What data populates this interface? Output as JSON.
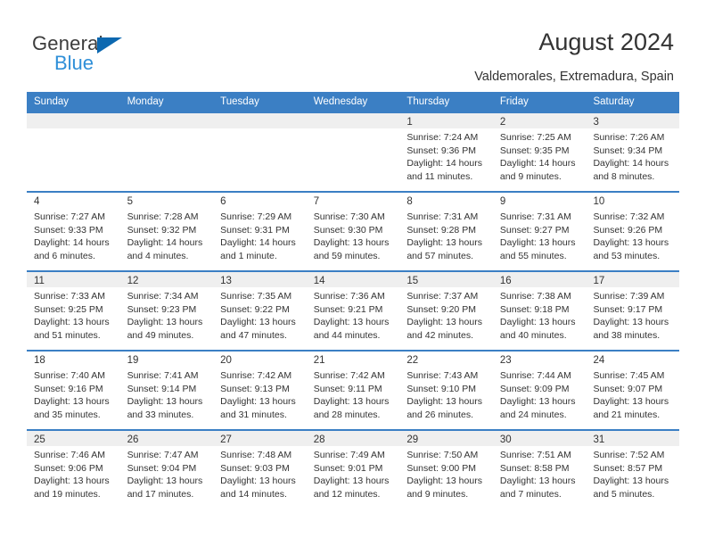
{
  "brand": {
    "name_top": "General",
    "name_bottom": "Blue",
    "triangle_icon": "triangle-icon",
    "accent_dark": "#0c68b0",
    "accent_light": "#2f8fd8"
  },
  "header": {
    "title": "August 2024",
    "subtitle": "Valdemorales, Extremadura, Spain"
  },
  "calendar": {
    "header_color": "#3b7fc4",
    "weekdays": [
      "Sunday",
      "Monday",
      "Tuesday",
      "Wednesday",
      "Thursday",
      "Friday",
      "Saturday"
    ],
    "weeks": [
      [
        {
          "day": "",
          "lines": []
        },
        {
          "day": "",
          "lines": []
        },
        {
          "day": "",
          "lines": []
        },
        {
          "day": "",
          "lines": []
        },
        {
          "day": "1",
          "lines": [
            "Sunrise: 7:24 AM",
            "Sunset: 9:36 PM",
            "Daylight: 14 hours",
            "and 11 minutes."
          ]
        },
        {
          "day": "2",
          "lines": [
            "Sunrise: 7:25 AM",
            "Sunset: 9:35 PM",
            "Daylight: 14 hours",
            "and 9 minutes."
          ]
        },
        {
          "day": "3",
          "lines": [
            "Sunrise: 7:26 AM",
            "Sunset: 9:34 PM",
            "Daylight: 14 hours",
            "and 8 minutes."
          ]
        }
      ],
      [
        {
          "day": "4",
          "lines": [
            "Sunrise: 7:27 AM",
            "Sunset: 9:33 PM",
            "Daylight: 14 hours",
            "and 6 minutes."
          ]
        },
        {
          "day": "5",
          "lines": [
            "Sunrise: 7:28 AM",
            "Sunset: 9:32 PM",
            "Daylight: 14 hours",
            "and 4 minutes."
          ]
        },
        {
          "day": "6",
          "lines": [
            "Sunrise: 7:29 AM",
            "Sunset: 9:31 PM",
            "Daylight: 14 hours",
            "and 1 minute."
          ]
        },
        {
          "day": "7",
          "lines": [
            "Sunrise: 7:30 AM",
            "Sunset: 9:30 PM",
            "Daylight: 13 hours",
            "and 59 minutes."
          ]
        },
        {
          "day": "8",
          "lines": [
            "Sunrise: 7:31 AM",
            "Sunset: 9:28 PM",
            "Daylight: 13 hours",
            "and 57 minutes."
          ]
        },
        {
          "day": "9",
          "lines": [
            "Sunrise: 7:31 AM",
            "Sunset: 9:27 PM",
            "Daylight: 13 hours",
            "and 55 minutes."
          ]
        },
        {
          "day": "10",
          "lines": [
            "Sunrise: 7:32 AM",
            "Sunset: 9:26 PM",
            "Daylight: 13 hours",
            "and 53 minutes."
          ]
        }
      ],
      [
        {
          "day": "11",
          "lines": [
            "Sunrise: 7:33 AM",
            "Sunset: 9:25 PM",
            "Daylight: 13 hours",
            "and 51 minutes."
          ]
        },
        {
          "day": "12",
          "lines": [
            "Sunrise: 7:34 AM",
            "Sunset: 9:23 PM",
            "Daylight: 13 hours",
            "and 49 minutes."
          ]
        },
        {
          "day": "13",
          "lines": [
            "Sunrise: 7:35 AM",
            "Sunset: 9:22 PM",
            "Daylight: 13 hours",
            "and 47 minutes."
          ]
        },
        {
          "day": "14",
          "lines": [
            "Sunrise: 7:36 AM",
            "Sunset: 9:21 PM",
            "Daylight: 13 hours",
            "and 44 minutes."
          ]
        },
        {
          "day": "15",
          "lines": [
            "Sunrise: 7:37 AM",
            "Sunset: 9:20 PM",
            "Daylight: 13 hours",
            "and 42 minutes."
          ]
        },
        {
          "day": "16",
          "lines": [
            "Sunrise: 7:38 AM",
            "Sunset: 9:18 PM",
            "Daylight: 13 hours",
            "and 40 minutes."
          ]
        },
        {
          "day": "17",
          "lines": [
            "Sunrise: 7:39 AM",
            "Sunset: 9:17 PM",
            "Daylight: 13 hours",
            "and 38 minutes."
          ]
        }
      ],
      [
        {
          "day": "18",
          "lines": [
            "Sunrise: 7:40 AM",
            "Sunset: 9:16 PM",
            "Daylight: 13 hours",
            "and 35 minutes."
          ]
        },
        {
          "day": "19",
          "lines": [
            "Sunrise: 7:41 AM",
            "Sunset: 9:14 PM",
            "Daylight: 13 hours",
            "and 33 minutes."
          ]
        },
        {
          "day": "20",
          "lines": [
            "Sunrise: 7:42 AM",
            "Sunset: 9:13 PM",
            "Daylight: 13 hours",
            "and 31 minutes."
          ]
        },
        {
          "day": "21",
          "lines": [
            "Sunrise: 7:42 AM",
            "Sunset: 9:11 PM",
            "Daylight: 13 hours",
            "and 28 minutes."
          ]
        },
        {
          "day": "22",
          "lines": [
            "Sunrise: 7:43 AM",
            "Sunset: 9:10 PM",
            "Daylight: 13 hours",
            "and 26 minutes."
          ]
        },
        {
          "day": "23",
          "lines": [
            "Sunrise: 7:44 AM",
            "Sunset: 9:09 PM",
            "Daylight: 13 hours",
            "and 24 minutes."
          ]
        },
        {
          "day": "24",
          "lines": [
            "Sunrise: 7:45 AM",
            "Sunset: 9:07 PM",
            "Daylight: 13 hours",
            "and 21 minutes."
          ]
        }
      ],
      [
        {
          "day": "25",
          "lines": [
            "Sunrise: 7:46 AM",
            "Sunset: 9:06 PM",
            "Daylight: 13 hours",
            "and 19 minutes."
          ]
        },
        {
          "day": "26",
          "lines": [
            "Sunrise: 7:47 AM",
            "Sunset: 9:04 PM",
            "Daylight: 13 hours",
            "and 17 minutes."
          ]
        },
        {
          "day": "27",
          "lines": [
            "Sunrise: 7:48 AM",
            "Sunset: 9:03 PM",
            "Daylight: 13 hours",
            "and 14 minutes."
          ]
        },
        {
          "day": "28",
          "lines": [
            "Sunrise: 7:49 AM",
            "Sunset: 9:01 PM",
            "Daylight: 13 hours",
            "and 12 minutes."
          ]
        },
        {
          "day": "29",
          "lines": [
            "Sunrise: 7:50 AM",
            "Sunset: 9:00 PM",
            "Daylight: 13 hours",
            "and 9 minutes."
          ]
        },
        {
          "day": "30",
          "lines": [
            "Sunrise: 7:51 AM",
            "Sunset: 8:58 PM",
            "Daylight: 13 hours",
            "and 7 minutes."
          ]
        },
        {
          "day": "31",
          "lines": [
            "Sunrise: 7:52 AM",
            "Sunset: 8:57 PM",
            "Daylight: 13 hours",
            "and 5 minutes."
          ]
        }
      ]
    ]
  }
}
